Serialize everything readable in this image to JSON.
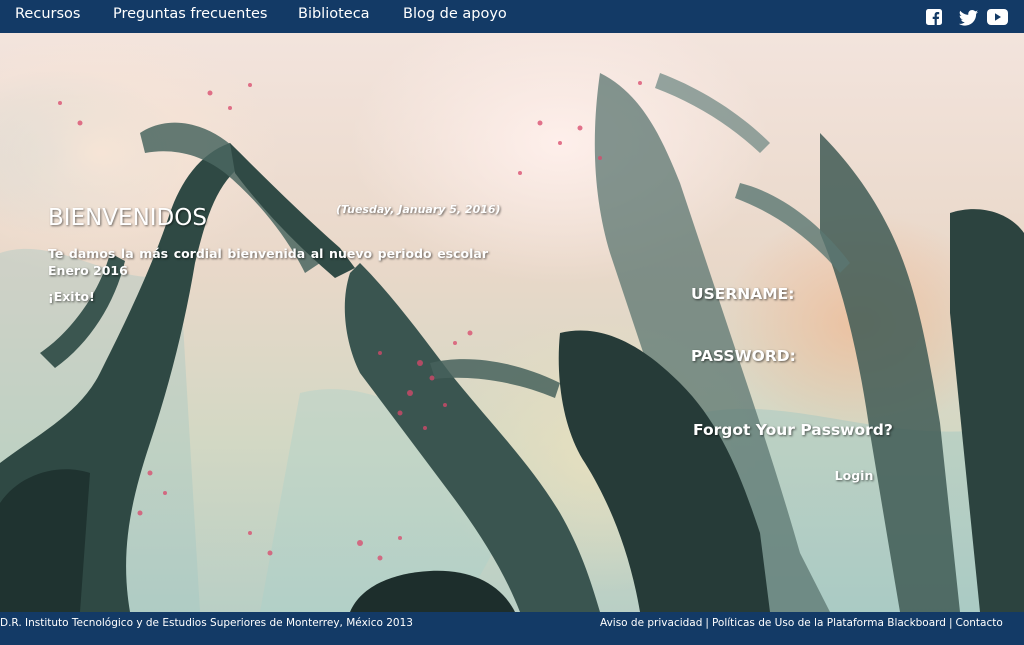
{
  "nav": {
    "items": [
      {
        "label": "Recursos"
      },
      {
        "label": "Preguntas frecuentes"
      },
      {
        "label": "Biblioteca"
      },
      {
        "label": "Blog de apoyo"
      }
    ],
    "social_icons": [
      "facebook-icon",
      "twitter-icon",
      "youtube-icon"
    ]
  },
  "welcome": {
    "title": "BIENVENIDOS",
    "date": "(Tuesday, January 5, 2016)",
    "message": "Te damos la más cordial bienvenida al nuevo periodo escolar Enero 2016",
    "closing": "¡Exito!"
  },
  "login": {
    "username_label": "USERNAME:",
    "password_label": "PASSWORD:",
    "forgot_link": "Forgot Your Password?",
    "submit_label": "Login"
  },
  "footer": {
    "copyright": "D.R. Instituto Tecnológico y de Estudios Superiores de Monterrey, México 2013",
    "links": [
      {
        "label": "Aviso de privacidad"
      },
      {
        "label": "Políticas de Uso de la Plataforma Blackboard"
      },
      {
        "label": "Contacto"
      }
    ],
    "separator": "|"
  },
  "colors": {
    "bar_background": "#133a66",
    "text": "#ffffff"
  }
}
